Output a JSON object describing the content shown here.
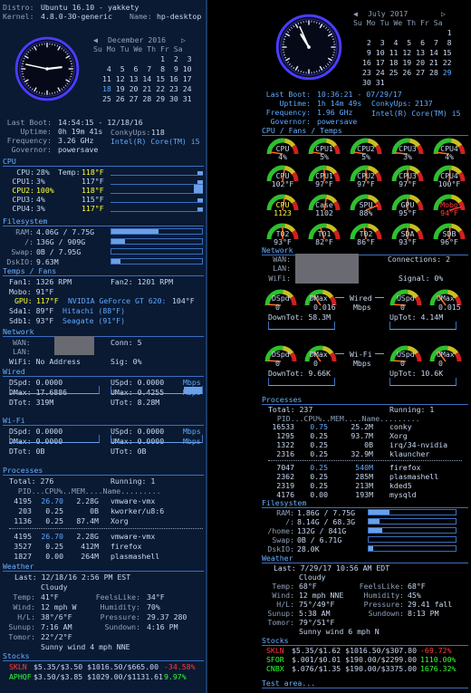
{
  "left": {
    "distro_label": "Distro:",
    "distro": "Ubuntu 16.10 - yakkety",
    "kernel_label": "Kernel:",
    "kernel": "4.8.0-30-generic",
    "name_label": "Name:",
    "name": "hp-desktop",
    "cal": {
      "month": "December 2016",
      "days": "Su Mo Tu We Th Fr Sa",
      "rows": [
        "             1  2  3",
        " 4  5  6  7  8  9 10",
        "11 12 13 14 15 16 17",
        "18 19 20 21 22 23 24",
        "25 26 27 28 29 30 31"
      ],
      "today": "18"
    },
    "boot": [
      [
        "Last Boot:",
        "14:54:15 - 12/18/16"
      ],
      [
        "Uptime:",
        "0h 19m 41s"
      ],
      [
        "Frequency:",
        "3.26 GHz"
      ],
      [
        "Governor:",
        "powersave"
      ]
    ],
    "conkyups_label": "ConkyUps:",
    "conkyups": "118",
    "cpu_model": "Intel(R) Core(TM) i5",
    "cpu_h": "CPU",
    "cpu": [
      {
        "l": "CPU:",
        "v": "28%"
      },
      {
        "l": "CPU1:",
        "v": "3%"
      },
      {
        "l": "CPU2:",
        "v": "100%"
      },
      {
        "l": "CPU3:",
        "v": "4%"
      },
      {
        "l": "CPU4:",
        "v": "3%"
      }
    ],
    "temps": [
      {
        "l": "Temp:",
        "v": "118°F"
      },
      {
        "l": "",
        "v": "117°F"
      },
      {
        "l": "",
        "v": "118°F"
      },
      {
        "l": "",
        "v": "115°F"
      },
      {
        "l": "",
        "v": "117°F"
      }
    ],
    "fs_h": "Filesystem",
    "fs": [
      {
        "l": "RAM:",
        "v": "4.06G / 7.75G",
        "f": 0.52
      },
      {
        "l": "/:",
        "v": "136G / 909G",
        "f": 0.15
      },
      {
        "l": "Swap:",
        "v": "0B / 7.95G",
        "f": 0.0
      },
      {
        "l": "DskIO:",
        "v": "9.63M",
        "f": 0.1
      }
    ],
    "tf_h": "Temps / Fans",
    "fan1": "Fan1: 1326 RPM",
    "fan2": "Fan2: 1201 RPM",
    "mobo": "Mobo: 91°F",
    "gpu": "GPU:",
    "gpu_t": "117°F",
    "gpu_name": "NVIDIA GeForce GT 620:",
    "gpu_t2": "104°F",
    "sda": "Sda1: 89°F",
    "sda_n": "Hitachi (88°F)",
    "sdb": "Sdb1: 93°F",
    "sdb_n": "Seagate (91°F)",
    "net_h": "Network",
    "wan": "WAN:",
    "conn": "Conn: 5",
    "lan": "LAN:",
    "wifi": "WiFi: No Address",
    "sig": "Sig: 0%",
    "wired_h": "Wired",
    "wired": [
      [
        "DSpd: 0.0000",
        "USpd: 0.0000",
        "Mbps"
      ],
      [
        "DMax: 17.6886",
        "UMax: 0.4255",
        "Mbps"
      ],
      [
        "DTot: 319M",
        "UTot: 8.28M",
        ""
      ]
    ],
    "wifi_h": "Wi-Fi",
    "wifin": [
      [
        "DSpd: 0.0000",
        "USpd: 0.0000",
        "Mbps"
      ],
      [
        "DMax: 0.0000",
        "UMax: 0.0000",
        "Mbps"
      ],
      [
        "DTot: 0B",
        "UTot: 0B",
        ""
      ]
    ],
    "proc_h": "Processes",
    "total": "Total: 276",
    "running": "Running: 1",
    "phead": "  PID...CPU%..MEM....Name.........",
    "procs1": [
      [
        "4195",
        "26.70",
        "2.28G",
        "vmware-vmx"
      ],
      [
        "203",
        "0.25",
        "0B",
        "kworker/u8:6"
      ],
      [
        "1136",
        "0.25",
        "87.4M",
        "Xorg"
      ]
    ],
    "procs2": [
      [
        "4195",
        "26.70",
        "2.28G",
        "vmware-vmx"
      ],
      [
        "3527",
        "0.25",
        "412M",
        "firefox"
      ],
      [
        "1827",
        "0.00",
        "264M",
        "plasmashell"
      ]
    ],
    "wx_h": "Weather",
    "wx_last": "Last: 12/18/16 2:56 PM EST",
    "wx_cond": "Cloudy",
    "wx": [
      [
        "Temp:",
        "41°F",
        "FeelsLike:",
        "34°F"
      ],
      [
        "Wind:",
        "12 mph W",
        "Humidity:",
        "70%"
      ],
      [
        "H/L:",
        "38°/6°F",
        "Pressure:",
        "29.37 280"
      ],
      [
        "Sunup:",
        "7:16 AM",
        "Sundown:",
        "4:16 PM"
      ],
      [
        "Tomor:",
        "22°/2°F",
        "",
        ""
      ]
    ],
    "wx_tom": "Sunny wind 4 mph NNE",
    "st_h": "Stocks",
    "stocks": [
      [
        "SKLN",
        "$5.35/$3.50 $1016.50/$665.00",
        "-34.58%",
        "r"
      ],
      [
        "APHQF",
        "$3.50/$3.85 $1029.00/$1131.61",
        "9.97%",
        "g"
      ]
    ]
  },
  "right": {
    "cal": {
      "month": "July 2017",
      "days": "Su Mo Tu We Th Fr Sa",
      "rows": [
        "                   1",
        " 2  3  4  5  6  7  8",
        " 9 10 11 12 13 14 15",
        "16 17 18 19 20 21 22",
        "23 24 25 26 27 28 29",
        "30 31"
      ],
      "today": "29"
    },
    "boot": [
      [
        "Last Boot:",
        "10:36:21 - 07/29/17"
      ],
      [
        "Uptime:",
        "1h 14m 49s"
      ],
      [
        "Frequency:",
        "1.96 GHz"
      ],
      [
        "Governor:",
        "powersave"
      ]
    ],
    "conkyups_label": "ConkyUps:",
    "conkyups": "2137",
    "cpu_model": "Intel(R) Core(TM) i5",
    "cft_h": "CPU / Fans / Temps",
    "g1": [
      [
        "CPU",
        "4%"
      ],
      [
        "CPU1",
        "5%"
      ],
      [
        "CPU2",
        "5%"
      ],
      [
        "CPU3",
        "3%"
      ],
      [
        "CPU4",
        "4%"
      ]
    ],
    "g2": [
      [
        "CPU",
        "102°F"
      ],
      [
        "CPU1",
        "97°F"
      ],
      [
        "CPU2",
        "97°F"
      ],
      [
        "CPU3",
        "97°F"
      ],
      [
        "CPU4",
        "100°F"
      ]
    ],
    "g3": [
      [
        "CPU",
        "1123"
      ],
      [
        "Case",
        "1102"
      ],
      [
        "SPU",
        "88%"
      ],
      [
        "GPU",
        "95°F"
      ],
      [
        "Mobo",
        "94°F"
      ]
    ],
    "g4": [
      [
        "T02",
        "93°F"
      ],
      [
        "T01",
        "82°F"
      ],
      [
        "T02",
        "86°F"
      ],
      [
        "SDA",
        "93°F"
      ],
      [
        "SDB",
        "96°F"
      ]
    ],
    "net_h": "Network",
    "wan": "WAN:",
    "lan": "LAN:",
    "wifi": "WiFi:",
    "conn": "Connections: 2",
    "sig": "Signal: 0%",
    "dspd": "DSpd",
    "dmax": "DMax",
    "uspd": "USpd",
    "umax": "UMax",
    "wired_lbl": "Wired",
    "wifi_lbl": "Wi-Fi",
    "mbps": "Mbps",
    "wd": [
      "0",
      "0.016",
      "0",
      "0.015"
    ],
    "wdt": "DownTot: 58.3M",
    "wut": "UpTot: 4.14M",
    "fd": [
      "0",
      "0",
      "0",
      "0"
    ],
    "fdt": "DownTot: 9.66K",
    "fut": "UpTot: 10.6K",
    "proc_h": "Processes",
    "total": "Total: 237",
    "running": "Running: 1",
    "phead": "  PID...CPU%..MEM....Name.........",
    "procs1": [
      [
        "16533",
        "0.75",
        "25.2M",
        "conky"
      ],
      [
        "1295",
        "0.25",
        "93.7M",
        "Xorg"
      ],
      [
        "1322",
        "0.25",
        "0B",
        "irq/34-nvidia"
      ],
      [
        "2316",
        "0.25",
        "32.9M",
        "klauncher"
      ]
    ],
    "procs2": [
      [
        "7047",
        "0.25",
        "540M",
        "firefox"
      ],
      [
        "2362",
        "0.25",
        "285M",
        "plasmashell"
      ],
      [
        "2319",
        "0.25",
        "213M",
        "kded5"
      ],
      [
        "4176",
        "0.00",
        "193M",
        "mysqld"
      ]
    ],
    "fs_h": "Filesystem",
    "fs": [
      {
        "l": "RAM:",
        "v": "1.86G / 7.75G",
        "f": 0.24
      },
      {
        "l": "/:",
        "v": "8.14G / 68.3G",
        "f": 0.12
      },
      {
        "l": "/home:",
        "v": "132G / 841G",
        "f": 0.16
      },
      {
        "l": "Swap:",
        "v": "0B / 6.71G",
        "f": 0.0
      },
      {
        "l": "DskIO:",
        "v": "28.0K",
        "f": 0.05
      }
    ],
    "wx_h": "Weather",
    "wx_last": "Last: 7/29/17 10:56 AM EDT",
    "wx_cond": "Cloudy",
    "wx": [
      [
        "Temp:",
        "68°F",
        "FeelsLike:",
        "68°F"
      ],
      [
        "Wind:",
        "12 mph NNE",
        "Humidity:",
        "45%"
      ],
      [
        "H/L:",
        "75°/49°F",
        "Pressure:",
        "29.41 fall"
      ],
      [
        "Sunup:",
        "5:38 AM",
        "Sundown:",
        "8:13 PM"
      ],
      [
        "Tomor:",
        "79°/51°F",
        "",
        ""
      ]
    ],
    "wx_tom": "Sunny wind 6 mph N",
    "st_h": "Stocks",
    "stocks": [
      [
        "SKLN",
        "$5.35/$1.62 $1016.50/$307.80",
        "-69.72%",
        "r"
      ],
      [
        "SFOR",
        "$.001/$0.01 $190.00/$2299.00",
        "1110.00%",
        "g"
      ],
      [
        "CNBX",
        "$.076/$1.35 $190.00/$3375.00",
        "1676.32%",
        "g"
      ]
    ],
    "test": "Test area..."
  }
}
